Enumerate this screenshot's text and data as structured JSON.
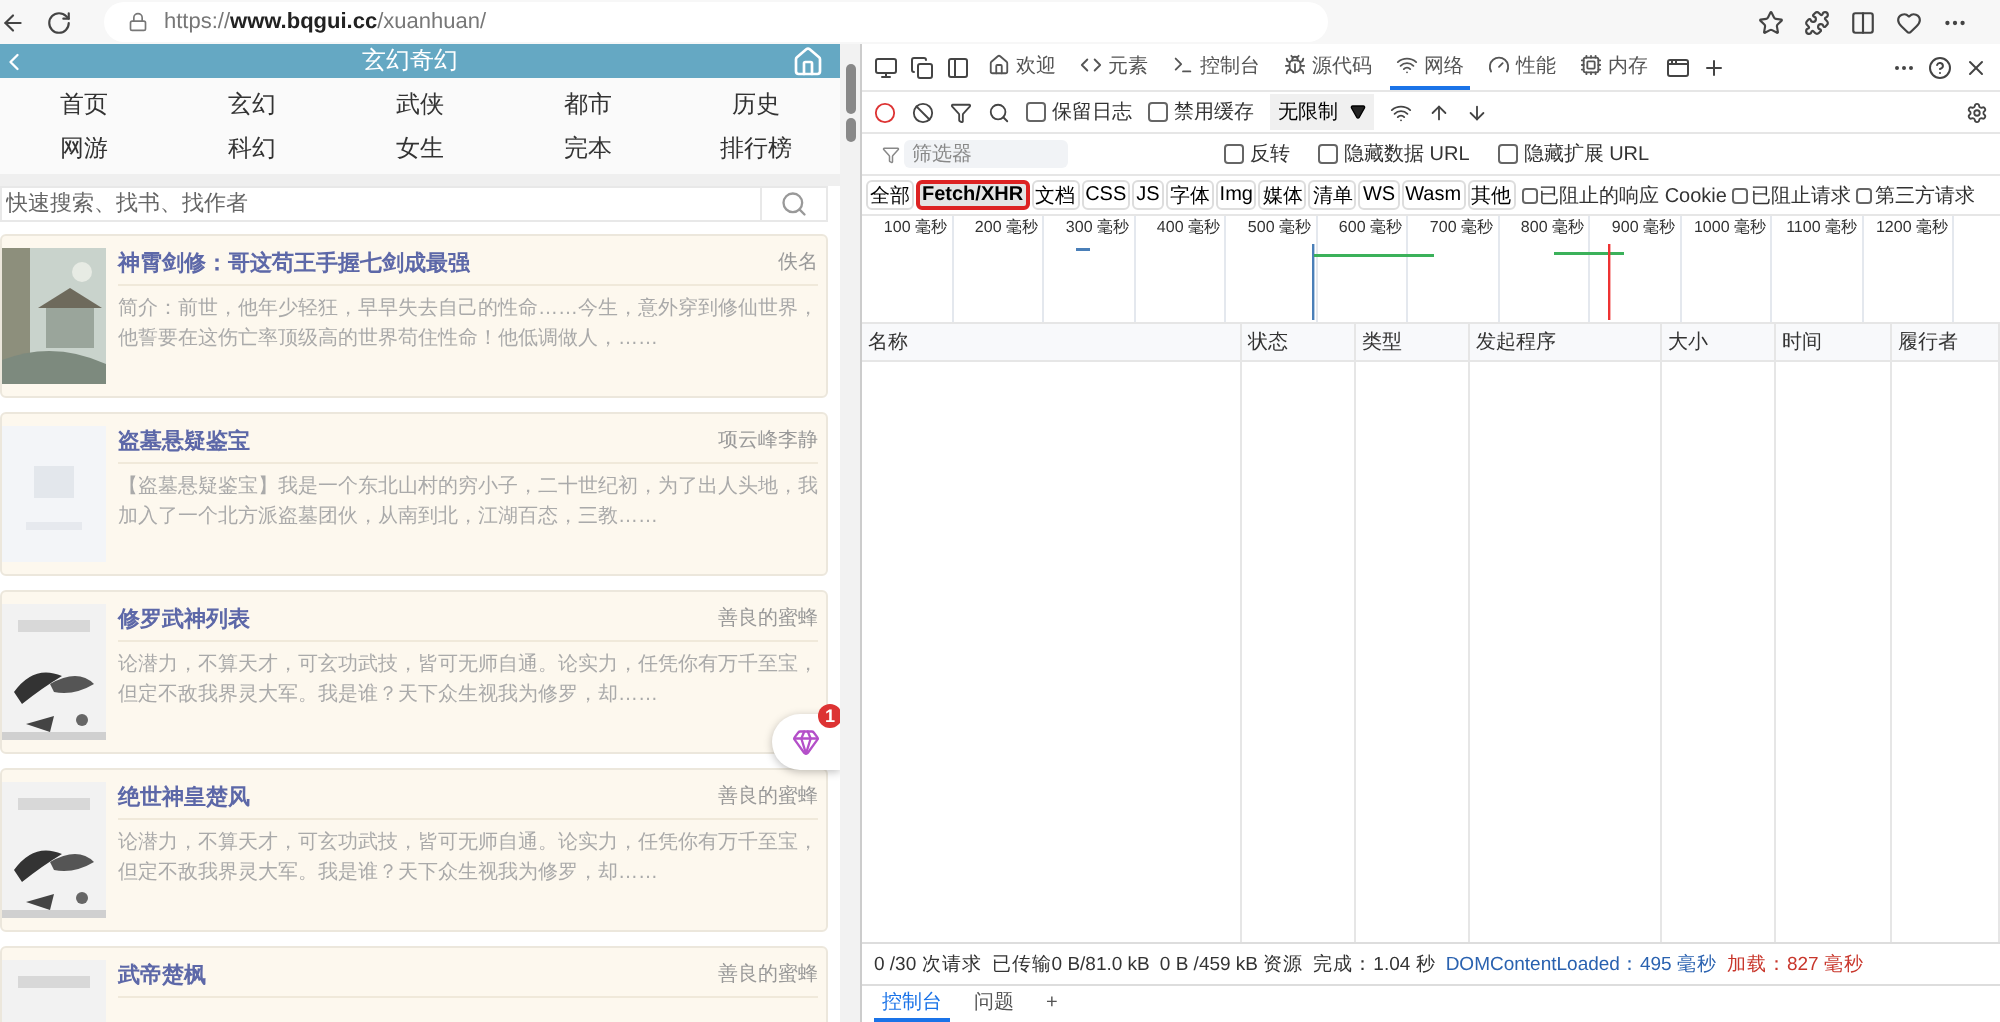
{
  "browser": {
    "url": "https://**www.bqgui.cc**/xuanhuan/"
  },
  "page": {
    "header_title": "玄幻奇幻",
    "nav": [
      "首页",
      "玄幻",
      "武侠",
      "都市",
      "历史",
      "网游",
      "科幻",
      "女生",
      "完本",
      "排行榜"
    ],
    "search": {
      "placeholder": "快速搜索、找书、找作者"
    },
    "books": [
      {
        "title": "神霄剑修：哥这苟王手握七剑成最强",
        "author": "佚名",
        "intro": "简介：前世，他年少轻狂，早早失去自己的性命……今生，意外穿到修仙世界，他誓要在这伤亡率顶级高的世界苟住性命！他低调做人，……"
      },
      {
        "title": "盗墓悬疑鉴宝",
        "author": "项云峰李静",
        "intro": "【盗墓悬疑鉴宝】我是一个东北山村的穷小子，二十世纪初，为了出人头地，我加入了一个北方派盗墓团伙，从南到北，江湖百态，三教……"
      },
      {
        "title": "修罗武神列表",
        "author": "善良的蜜蜂",
        "intro": "论潜力，不算天才，可玄功武技，皆可无师自通。论实力，任凭你有万千至宝，但定不敌我界灵大军。我是谁？天下众生视我为修罗，却……"
      },
      {
        "title": "绝世神皇楚风",
        "author": "善良的蜜蜂",
        "intro": "论潜力，不算天才，可玄功武技，皆可无师自通。论实力，任凭你有万千至宝，但定不敌我界灵大军。我是谁？天下众生视我为修罗，却……"
      },
      {
        "title": "武帝楚枫",
        "author": "善良的蜜蜂"
      }
    ],
    "floating_badge": "1"
  },
  "devtools": {
    "tabs": [
      {
        "label": "欢迎",
        "selected": false
      },
      {
        "label": "元素",
        "selected": false
      },
      {
        "label": "控制台",
        "selected": false
      },
      {
        "label": "源代码",
        "selected": false
      },
      {
        "label": "网络",
        "selected": true
      },
      {
        "label": "性能",
        "selected": false
      },
      {
        "label": "内存",
        "selected": false
      }
    ],
    "toolbar": {
      "preserve_log": {
        "label": "保留日志",
        "checked": false
      },
      "disable_cache": {
        "label": "禁用缓存",
        "checked": false
      },
      "throttling": "无限制"
    },
    "filter": {
      "placeholder": "筛选器",
      "options": [
        {
          "label": "反转",
          "checked": false
        },
        {
          "label": "隐藏数据 URL",
          "checked": false
        },
        {
          "label": "隐藏扩展 URL",
          "checked": false
        }
      ]
    },
    "types": [
      {
        "label": "全部",
        "selected": false
      },
      {
        "label": "Fetch/XHR",
        "selected": true
      },
      {
        "label": "文档",
        "selected": false
      },
      {
        "label": "CSS",
        "selected": false
      },
      {
        "label": "JS",
        "selected": false
      },
      {
        "label": "字体",
        "selected": false
      },
      {
        "label": "Img",
        "selected": false
      },
      {
        "label": "媒体",
        "selected": false
      },
      {
        "label": "清单",
        "selected": false
      },
      {
        "label": "WS",
        "selected": false
      },
      {
        "label": "Wasm",
        "selected": false
      },
      {
        "label": "其他",
        "selected": false
      }
    ],
    "type_options": [
      {
        "label": "已阻止的响应 Cookie",
        "checked": false
      },
      {
        "label": "已阻止请求",
        "checked": false
      },
      {
        "label": "第三方请求",
        "checked": false
      }
    ],
    "timeline_ticks": [
      "100 毫秒",
      "200 毫秒",
      "300 毫秒",
      "400 毫秒",
      "500 毫秒",
      "600 毫秒",
      "700 毫秒",
      "800 毫秒",
      "900 毫秒",
      "1000 毫秒",
      "1100 毫秒",
      "1200 毫秒"
    ],
    "columns": [
      "名称",
      "状态",
      "类型",
      "发起程序",
      "大小",
      "时间",
      "履行者"
    ],
    "status": [
      {
        "text": "0 /30 次请求",
        "color": "#333333"
      },
      {
        "text": "已传输0 B/81.0 kB",
        "color": "#333333"
      },
      {
        "text": "0 B /459 kB 资源",
        "color": "#333333"
      },
      {
        "text": "完成：1.04 秒",
        "color": "#333333"
      },
      {
        "text": "DOMContentLoaded：495 毫秒",
        "color": "#2a62b0"
      },
      {
        "text": "加载：827 毫秒",
        "color": "#c8362b"
      }
    ],
    "drawer_tabs": [
      {
        "label": "控制台",
        "selected": true
      },
      {
        "label": "问题",
        "selected": false
      },
      {
        "label": "+",
        "selected": false
      }
    ]
  }
}
